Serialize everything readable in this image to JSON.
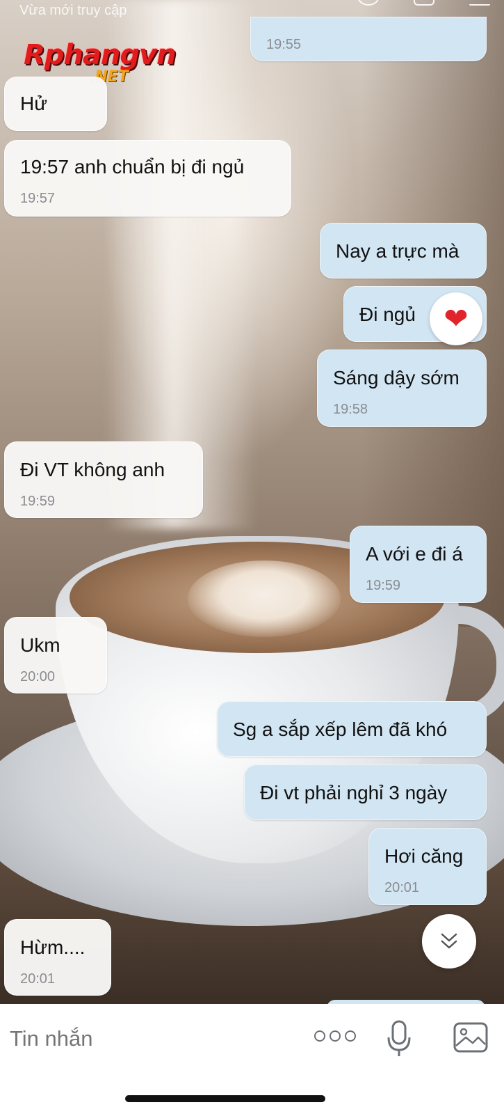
{
  "header": {
    "status": "Vừa mới truy cập"
  },
  "watermark": {
    "logo": "Rphangvn",
    "logo_sub": ".NET"
  },
  "messages": [
    {
      "dir": "out",
      "text": "",
      "time": "19:55"
    },
    {
      "dir": "in",
      "text": "Hử",
      "time": ""
    },
    {
      "dir": "in",
      "text": "19:57 anh chuẩn bị đi ngủ",
      "time": "19:57"
    },
    {
      "dir": "out",
      "text": "Nay a trực mà",
      "time": ""
    },
    {
      "dir": "out",
      "text": "Đi ngủ",
      "time": "",
      "reaction": "heart"
    },
    {
      "dir": "out",
      "text": "Sáng dậy sớm",
      "time": "19:58"
    },
    {
      "dir": "in",
      "text": "Đi VT không anh",
      "time": "19:59"
    },
    {
      "dir": "out",
      "text": "A với e đi á",
      "time": "19:59"
    },
    {
      "dir": "in",
      "text": "Ukm",
      "time": "20:00"
    },
    {
      "dir": "out",
      "text": "Sg a sắp xếp lêm đã khó",
      "time": ""
    },
    {
      "dir": "out",
      "text": "Đi vt phải nghỉ 3 ngày",
      "time": ""
    },
    {
      "dir": "out",
      "text": "Hơi căng",
      "time": "20:01"
    },
    {
      "dir": "in",
      "text": "Hừm....",
      "time": "20:01"
    }
  ],
  "reaction_icon": "heart-icon",
  "composer": {
    "placeholder": "Tin nhắn"
  },
  "colors": {
    "bubble_in": "#f8f7f5",
    "bubble_out": "#d2e5f3",
    "reaction": "#e0242b"
  }
}
